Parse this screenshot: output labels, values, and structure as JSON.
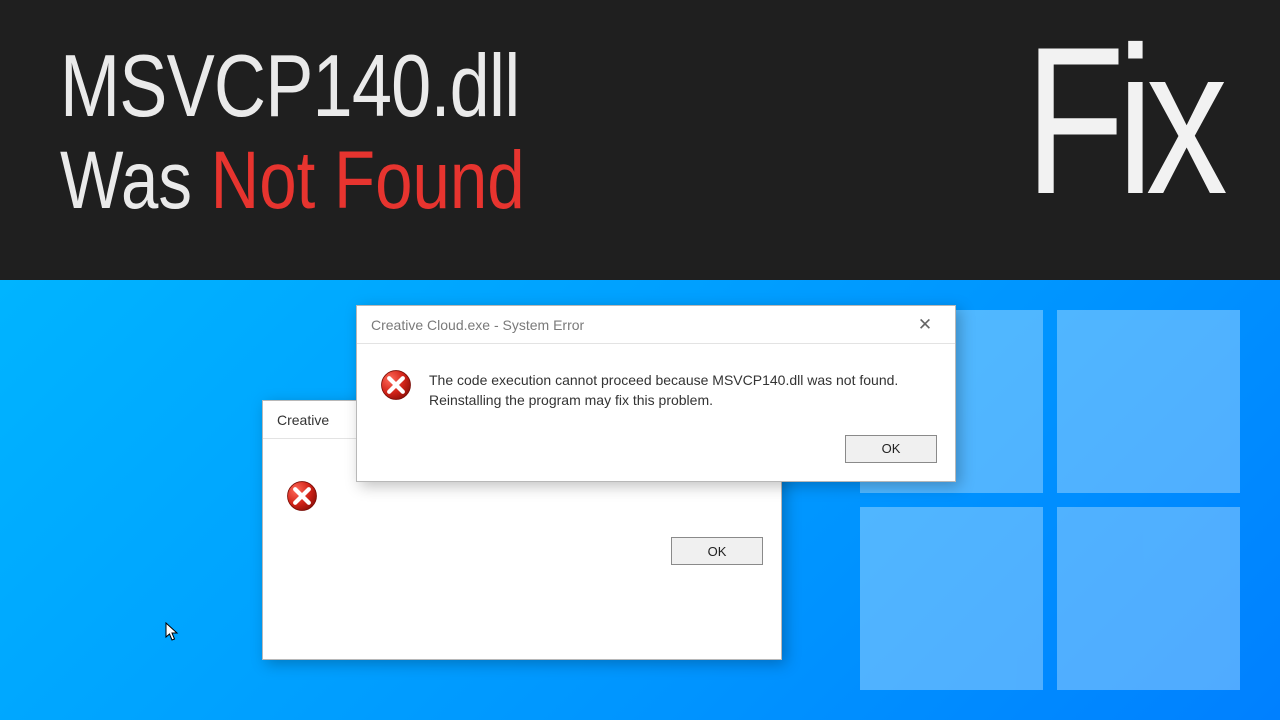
{
  "banner": {
    "title": "MSVCP140.dll",
    "sub_plain": "Was ",
    "sub_red": "Not Found",
    "fix": "Fix"
  },
  "dialog_front": {
    "title": "Creative Cloud.exe - System Error",
    "message": "The code execution cannot proceed because MSVCP140.dll was not found. Reinstalling the program may fix this problem.",
    "ok": "OK"
  },
  "dialog_back": {
    "title_visible": "Creative",
    "ok": "OK"
  }
}
